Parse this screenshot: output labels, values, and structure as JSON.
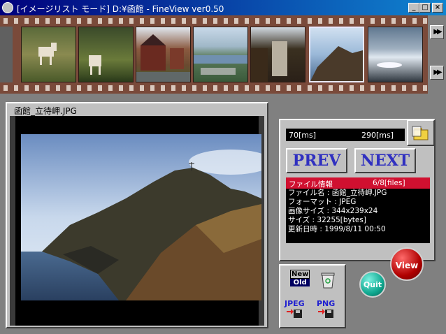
{
  "window": {
    "title": "[イメージリスト モード] D:¥函館 - FineView ver0.50",
    "minimize": "_",
    "maximize": "□",
    "close": "×"
  },
  "filmstrip": {
    "prev_arrows": "▶▶",
    "next_arrows": "▶▶",
    "selected_index": 6,
    "frames": [
      {
        "name": "thumb-pony-field"
      },
      {
        "name": "thumb-pony-trees"
      },
      {
        "name": "thumb-brick-house"
      },
      {
        "name": "thumb-harbor-view"
      },
      {
        "name": "thumb-building-trees"
      },
      {
        "name": "thumb-cape-tachimachi"
      },
      {
        "name": "thumb-sea-sunlight"
      }
    ]
  },
  "viewer": {
    "filename": "函館_立待岬.JPG"
  },
  "control": {
    "speed_min": "70[ms]",
    "speed_max": "290[ms]",
    "prev_label": "PREV",
    "next_label": "NEXT",
    "info_title": "ファイル情報",
    "info_count": "6/8[files]",
    "info_lines": [
      "ファイル名 : 函館_立待岬.JPG",
      "フォーマット : JPEG",
      "画像サイズ : 344x239x24",
      "サイズ : 32255[bytes]",
      "更新日時 : 1999/8/11 00:50"
    ],
    "view_label": "View",
    "quit_label": "Quit"
  },
  "tools": {
    "new_label": "New",
    "old_label": "Old",
    "jpeg_label": "JPEG",
    "png_label": "PNG"
  },
  "colors": {
    "titlebar": "#00007c",
    "film": "#7a4a3a",
    "accent_text": "#3030c0",
    "info_header": "#d01030"
  }
}
